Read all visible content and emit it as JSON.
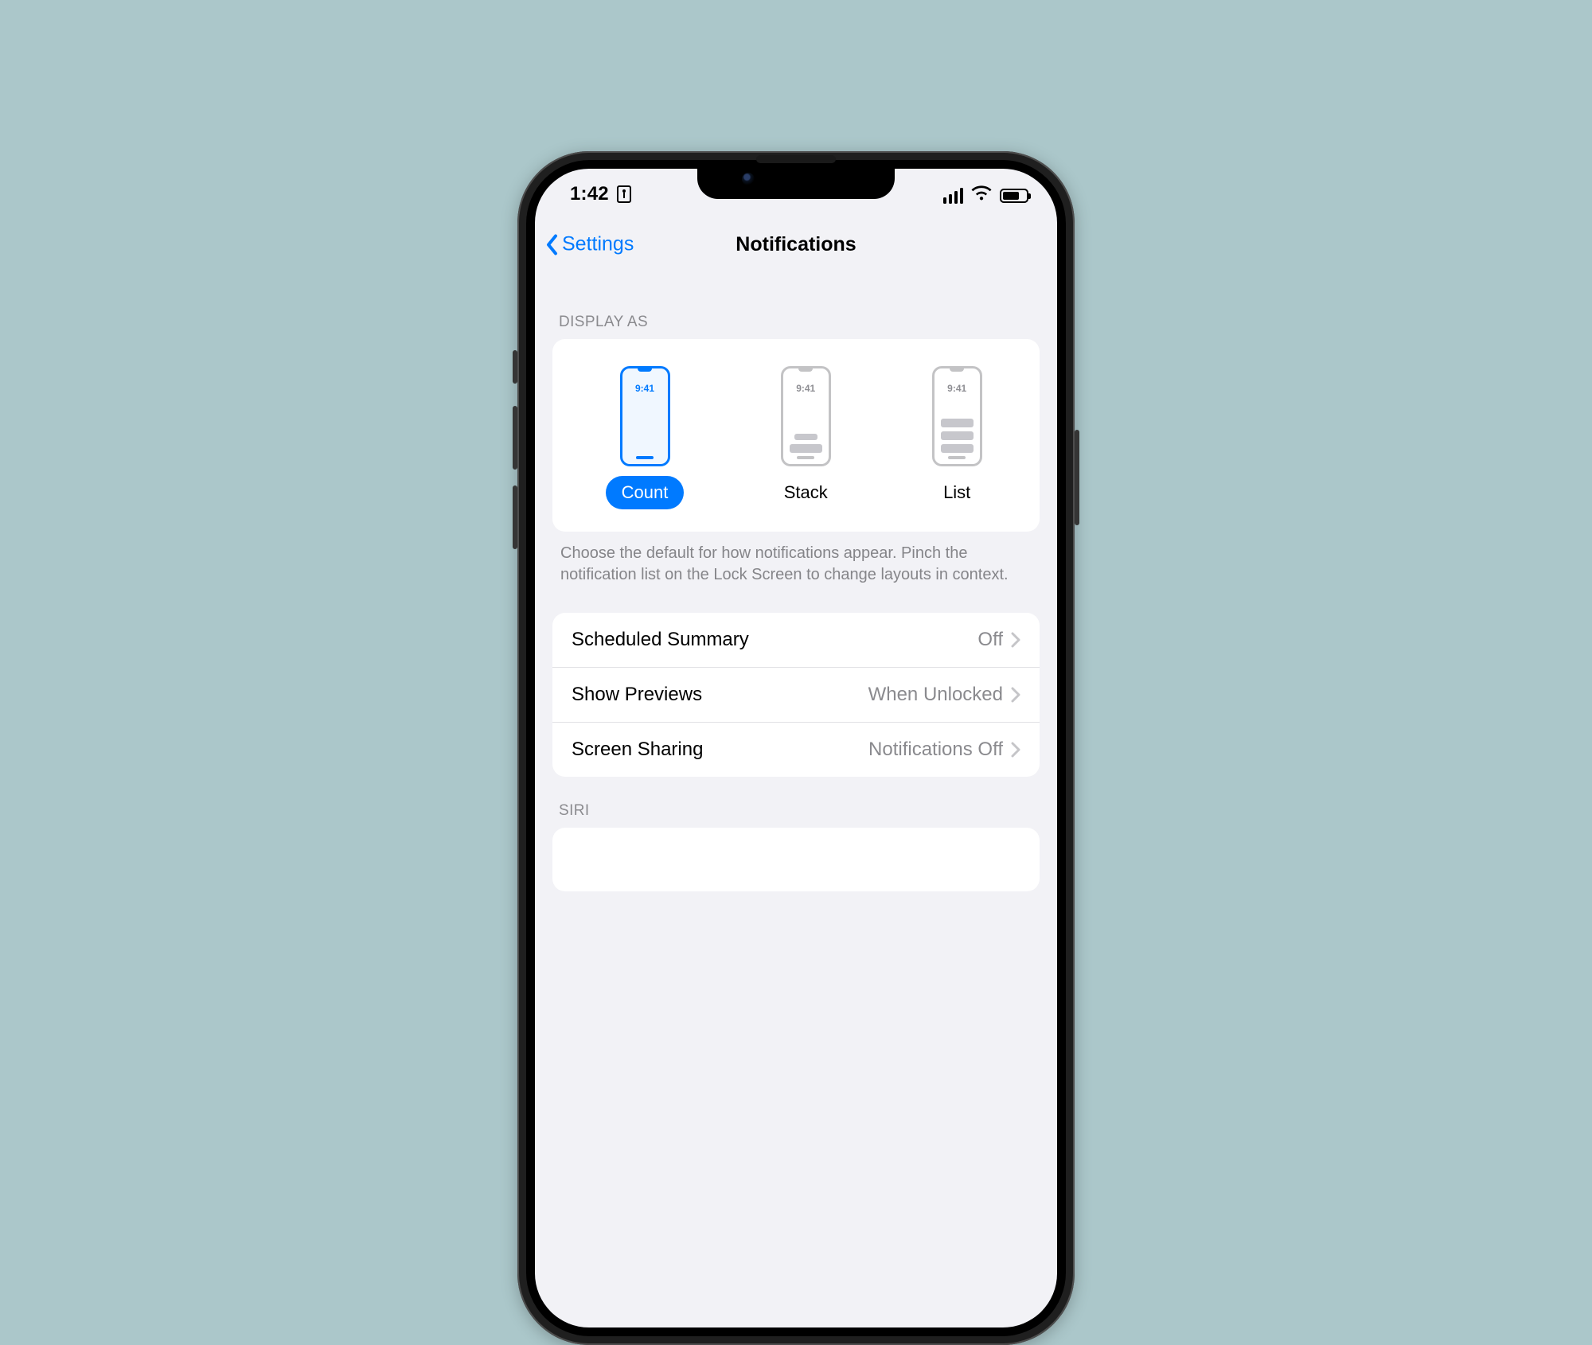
{
  "status": {
    "time": "1:42"
  },
  "navbar": {
    "back_label": "Settings",
    "title": "Notifications"
  },
  "display_as": {
    "header": "DISPLAY AS",
    "preview_time": "9:41",
    "options": [
      {
        "label": "Count",
        "selected": true
      },
      {
        "label": "Stack",
        "selected": false
      },
      {
        "label": "List",
        "selected": false
      }
    ],
    "footer": "Choose the default for how notifications appear. Pinch the notification list on the Lock Screen to change layouts in context."
  },
  "rows": [
    {
      "label": "Scheduled Summary",
      "value": "Off"
    },
    {
      "label": "Show Previews",
      "value": "When Unlocked"
    },
    {
      "label": "Screen Sharing",
      "value": "Notifications Off"
    }
  ],
  "siri_header": "SIRI"
}
